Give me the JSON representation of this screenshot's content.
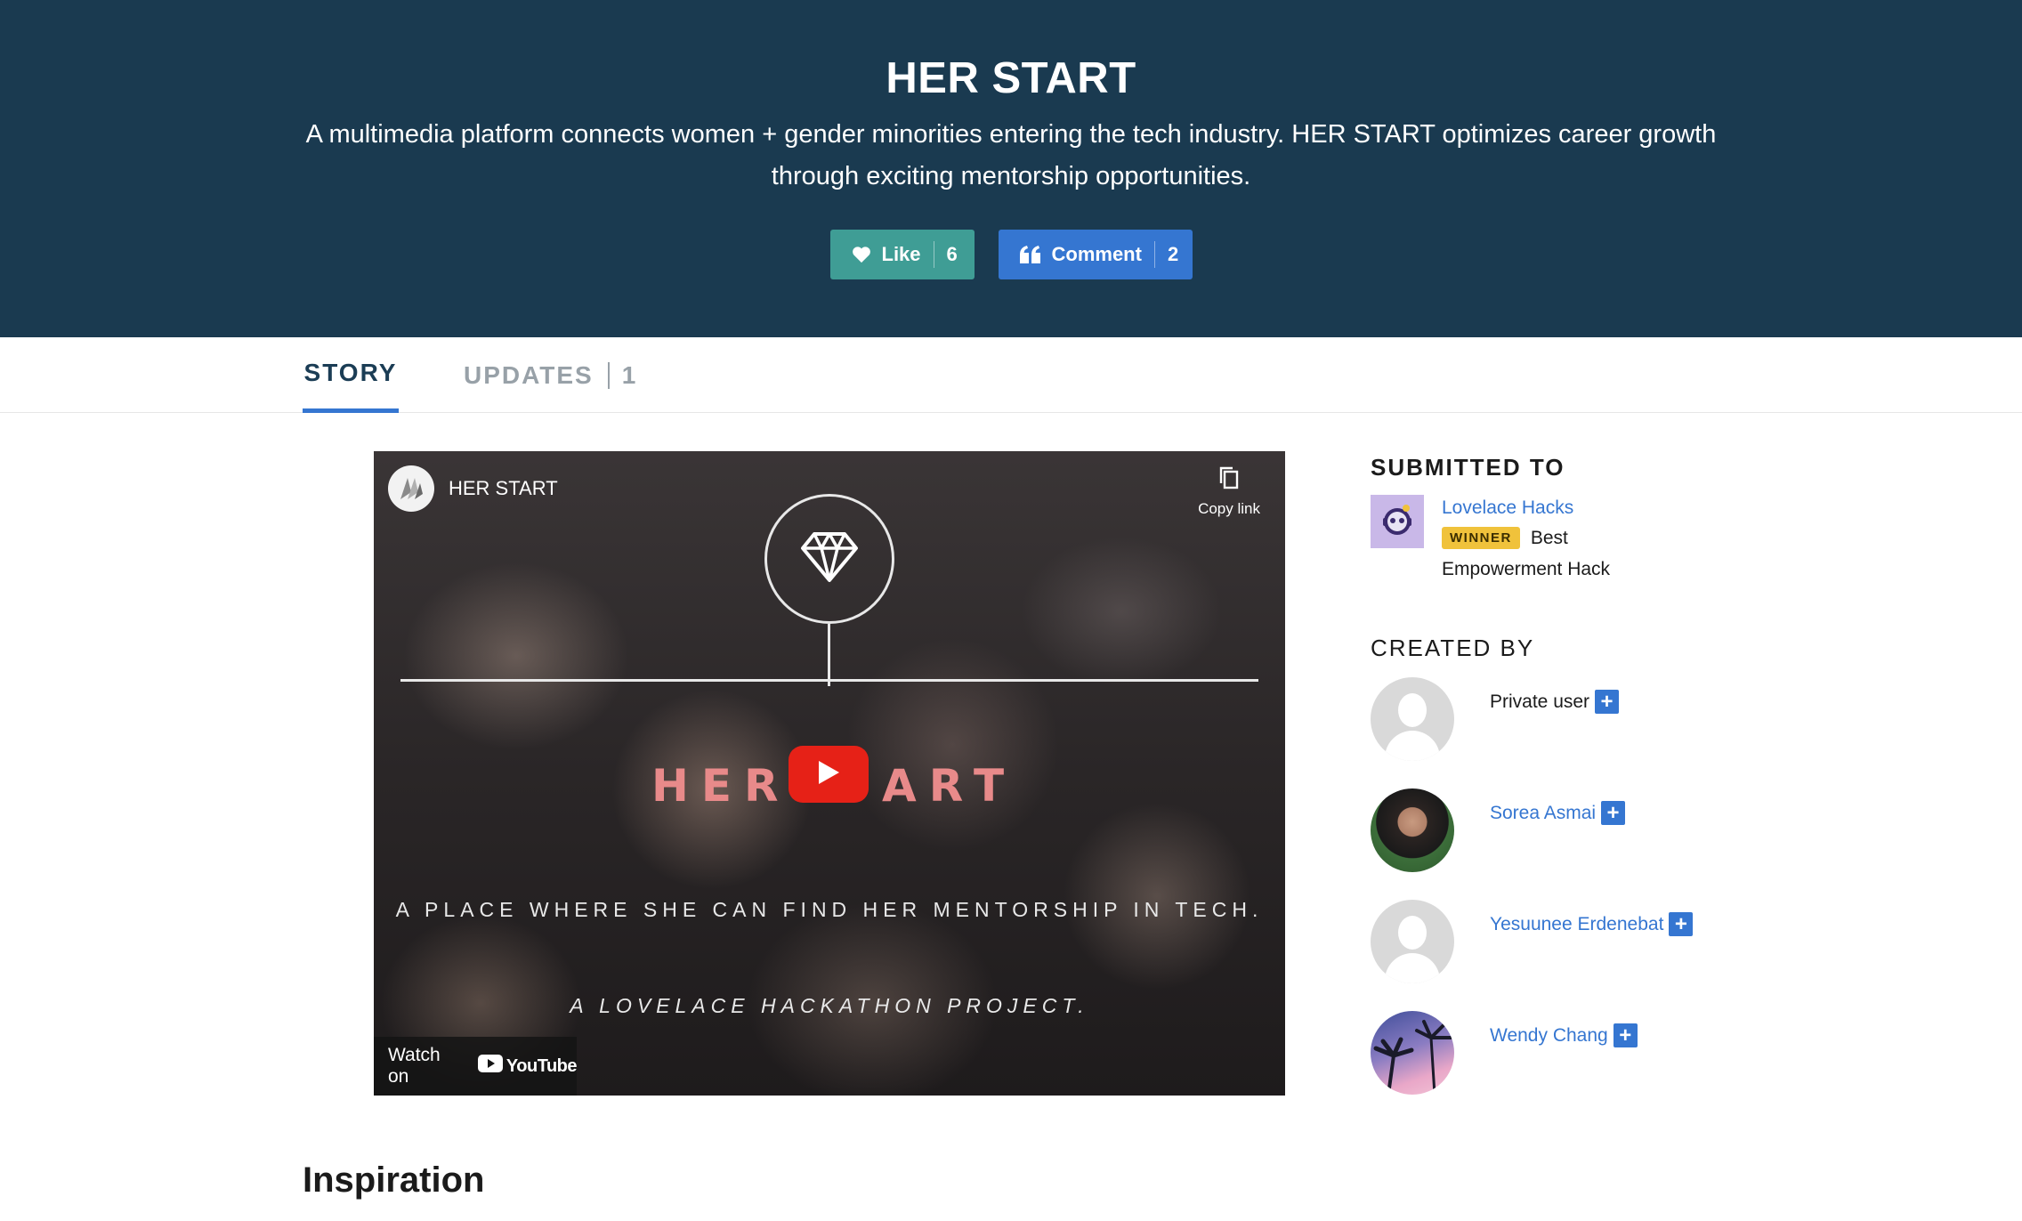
{
  "hero": {
    "title": "HER START",
    "tagline": "A multimedia platform connects women + gender minorities entering the tech industry. HER START optimizes career growth through exciting mentorship opportunities.",
    "like_label": "Like",
    "like_count": "6",
    "comment_label": "Comment",
    "comment_count": "2"
  },
  "tabs": {
    "story": "STORY",
    "updates": "UPDATES",
    "updates_count": "1"
  },
  "video": {
    "channel": "HER START",
    "copy_link": "Copy link",
    "brand_left": "HER",
    "brand_right": "ART",
    "tagline": "A PLACE WHERE SHE CAN FIND HER MENTORSHIP IN TECH.",
    "project": "A LOVELACE HACKATHON PROJECT.",
    "watch_on": "Watch on",
    "youtube": "YouTube"
  },
  "sidebar": {
    "submitted_heading": "SUBMITTED TO",
    "hackathon": "Lovelace Hacks",
    "winner_badge": "WINNER",
    "prize_line1": "Best",
    "prize_line2": "Empowerment Hack",
    "created_heading": "CREATED BY",
    "members": [
      {
        "name": "Private user"
      },
      {
        "name": "Sorea Asmai"
      },
      {
        "name": "Yesuunee Erdenebat"
      },
      {
        "name": "Wendy Chang"
      }
    ]
  },
  "main": {
    "inspiration_heading": "Inspiration"
  },
  "colors": {
    "hero_bg": "#1a3a50",
    "like_btn": "#3f9d95",
    "comment_btn": "#3576d1",
    "link": "#3576d1",
    "winner_badge": "#f0c23b",
    "youtube_red": "#e62117"
  }
}
